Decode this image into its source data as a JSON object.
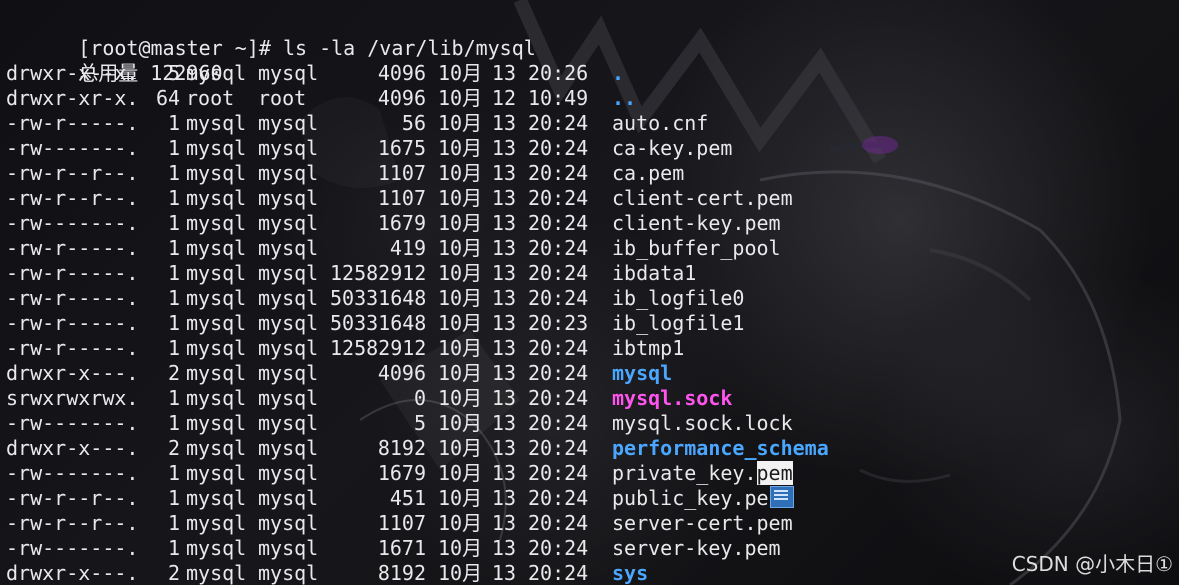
{
  "terminal": {
    "prompt": "[root@master ~]# ls -la /var/lib/mysql",
    "total": "总用量 122960",
    "entries": [
      {
        "perm": "drwxr-x--x.",
        "links": "5",
        "owner": "mysql",
        "group": "mysql",
        "size": "4096",
        "month": "10月",
        "day": "13",
        "time": "20:26",
        "name": "."
      },
      {
        "perm": "drwxr-xr-x.",
        "links": "64",
        "owner": "root",
        "group": "root",
        "size": "4096",
        "month": "10月",
        "day": "12",
        "time": "10:49",
        "name": ".."
      },
      {
        "perm": "-rw-r-----.",
        "links": "1",
        "owner": "mysql",
        "group": "mysql",
        "size": "56",
        "month": "10月",
        "day": "13",
        "time": "20:24",
        "name": "auto.cnf"
      },
      {
        "perm": "-rw-------.",
        "links": "1",
        "owner": "mysql",
        "group": "mysql",
        "size": "1675",
        "month": "10月",
        "day": "13",
        "time": "20:24",
        "name": "ca-key.pem"
      },
      {
        "perm": "-rw-r--r--.",
        "links": "1",
        "owner": "mysql",
        "group": "mysql",
        "size": "1107",
        "month": "10月",
        "day": "13",
        "time": "20:24",
        "name": "ca.pem"
      },
      {
        "perm": "-rw-r--r--.",
        "links": "1",
        "owner": "mysql",
        "group": "mysql",
        "size": "1107",
        "month": "10月",
        "day": "13",
        "time": "20:24",
        "name": "client-cert.pem"
      },
      {
        "perm": "-rw-------.",
        "links": "1",
        "owner": "mysql",
        "group": "mysql",
        "size": "1679",
        "month": "10月",
        "day": "13",
        "time": "20:24",
        "name": "client-key.pem"
      },
      {
        "perm": "-rw-r-----.",
        "links": "1",
        "owner": "mysql",
        "group": "mysql",
        "size": "419",
        "month": "10月",
        "day": "13",
        "time": "20:24",
        "name": "ib_buffer_pool"
      },
      {
        "perm": "-rw-r-----.",
        "links": "1",
        "owner": "mysql",
        "group": "mysql",
        "size": "12582912",
        "month": "10月",
        "day": "13",
        "time": "20:24",
        "name": "ibdata1"
      },
      {
        "perm": "-rw-r-----.",
        "links": "1",
        "owner": "mysql",
        "group": "mysql",
        "size": "50331648",
        "month": "10月",
        "day": "13",
        "time": "20:24",
        "name": "ib_logfile0"
      },
      {
        "perm": "-rw-r-----.",
        "links": "1",
        "owner": "mysql",
        "group": "mysql",
        "size": "50331648",
        "month": "10月",
        "day": "13",
        "time": "20:23",
        "name": "ib_logfile1"
      },
      {
        "perm": "-rw-r-----.",
        "links": "1",
        "owner": "mysql",
        "group": "mysql",
        "size": "12582912",
        "month": "10月",
        "day": "13",
        "time": "20:24",
        "name": "ibtmp1"
      },
      {
        "perm": "drwxr-x---.",
        "links": "2",
        "owner": "mysql",
        "group": "mysql",
        "size": "4096",
        "month": "10月",
        "day": "13",
        "time": "20:24",
        "name": "mysql"
      },
      {
        "perm": "srwxrwxrwx.",
        "links": "1",
        "owner": "mysql",
        "group": "mysql",
        "size": "0",
        "month": "10月",
        "day": "13",
        "time": "20:24",
        "name": "mysql.sock"
      },
      {
        "perm": "-rw-------.",
        "links": "1",
        "owner": "mysql",
        "group": "mysql",
        "size": "5",
        "month": "10月",
        "day": "13",
        "time": "20:24",
        "name": "mysql.sock.lock"
      },
      {
        "perm": "drwxr-x---.",
        "links": "2",
        "owner": "mysql",
        "group": "mysql",
        "size": "8192",
        "month": "10月",
        "day": "13",
        "time": "20:24",
        "name": "performance_schema"
      },
      {
        "perm": "-rw-------.",
        "links": "1",
        "owner": "mysql",
        "group": "mysql",
        "size": "1679",
        "month": "10月",
        "day": "13",
        "time": "20:24",
        "name": "private_key.",
        "name_selected": "pem"
      },
      {
        "perm": "-rw-r--r--.",
        "links": "1",
        "owner": "mysql",
        "group": "mysql",
        "size": "451",
        "month": "10月",
        "day": "13",
        "time": "20:24",
        "name": "public_key.pe",
        "cursor_icon": "ime-keyboard-icon"
      },
      {
        "perm": "-rw-r--r--.",
        "links": "1",
        "owner": "mysql",
        "group": "mysql",
        "size": "1107",
        "month": "10月",
        "day": "13",
        "time": "20:24",
        "name": "server-cert.pem"
      },
      {
        "perm": "-rw-------.",
        "links": "1",
        "owner": "mysql",
        "group": "mysql",
        "size": "1671",
        "month": "10月",
        "day": "13",
        "time": "20:24",
        "name": "server-key.pem"
      },
      {
        "perm": "drwxr-x---.",
        "links": "2",
        "owner": "mysql",
        "group": "mysql",
        "size": "8192",
        "month": "10月",
        "day": "13",
        "time": "20:24",
        "name": "sys"
      }
    ]
  },
  "watermark": "CSDN @小木日①",
  "colors": {
    "text": "#e9e9ec",
    "directory": "#4aa7ff",
    "socket": "#ff55ee",
    "selection_bg": "#f2f2f2"
  }
}
